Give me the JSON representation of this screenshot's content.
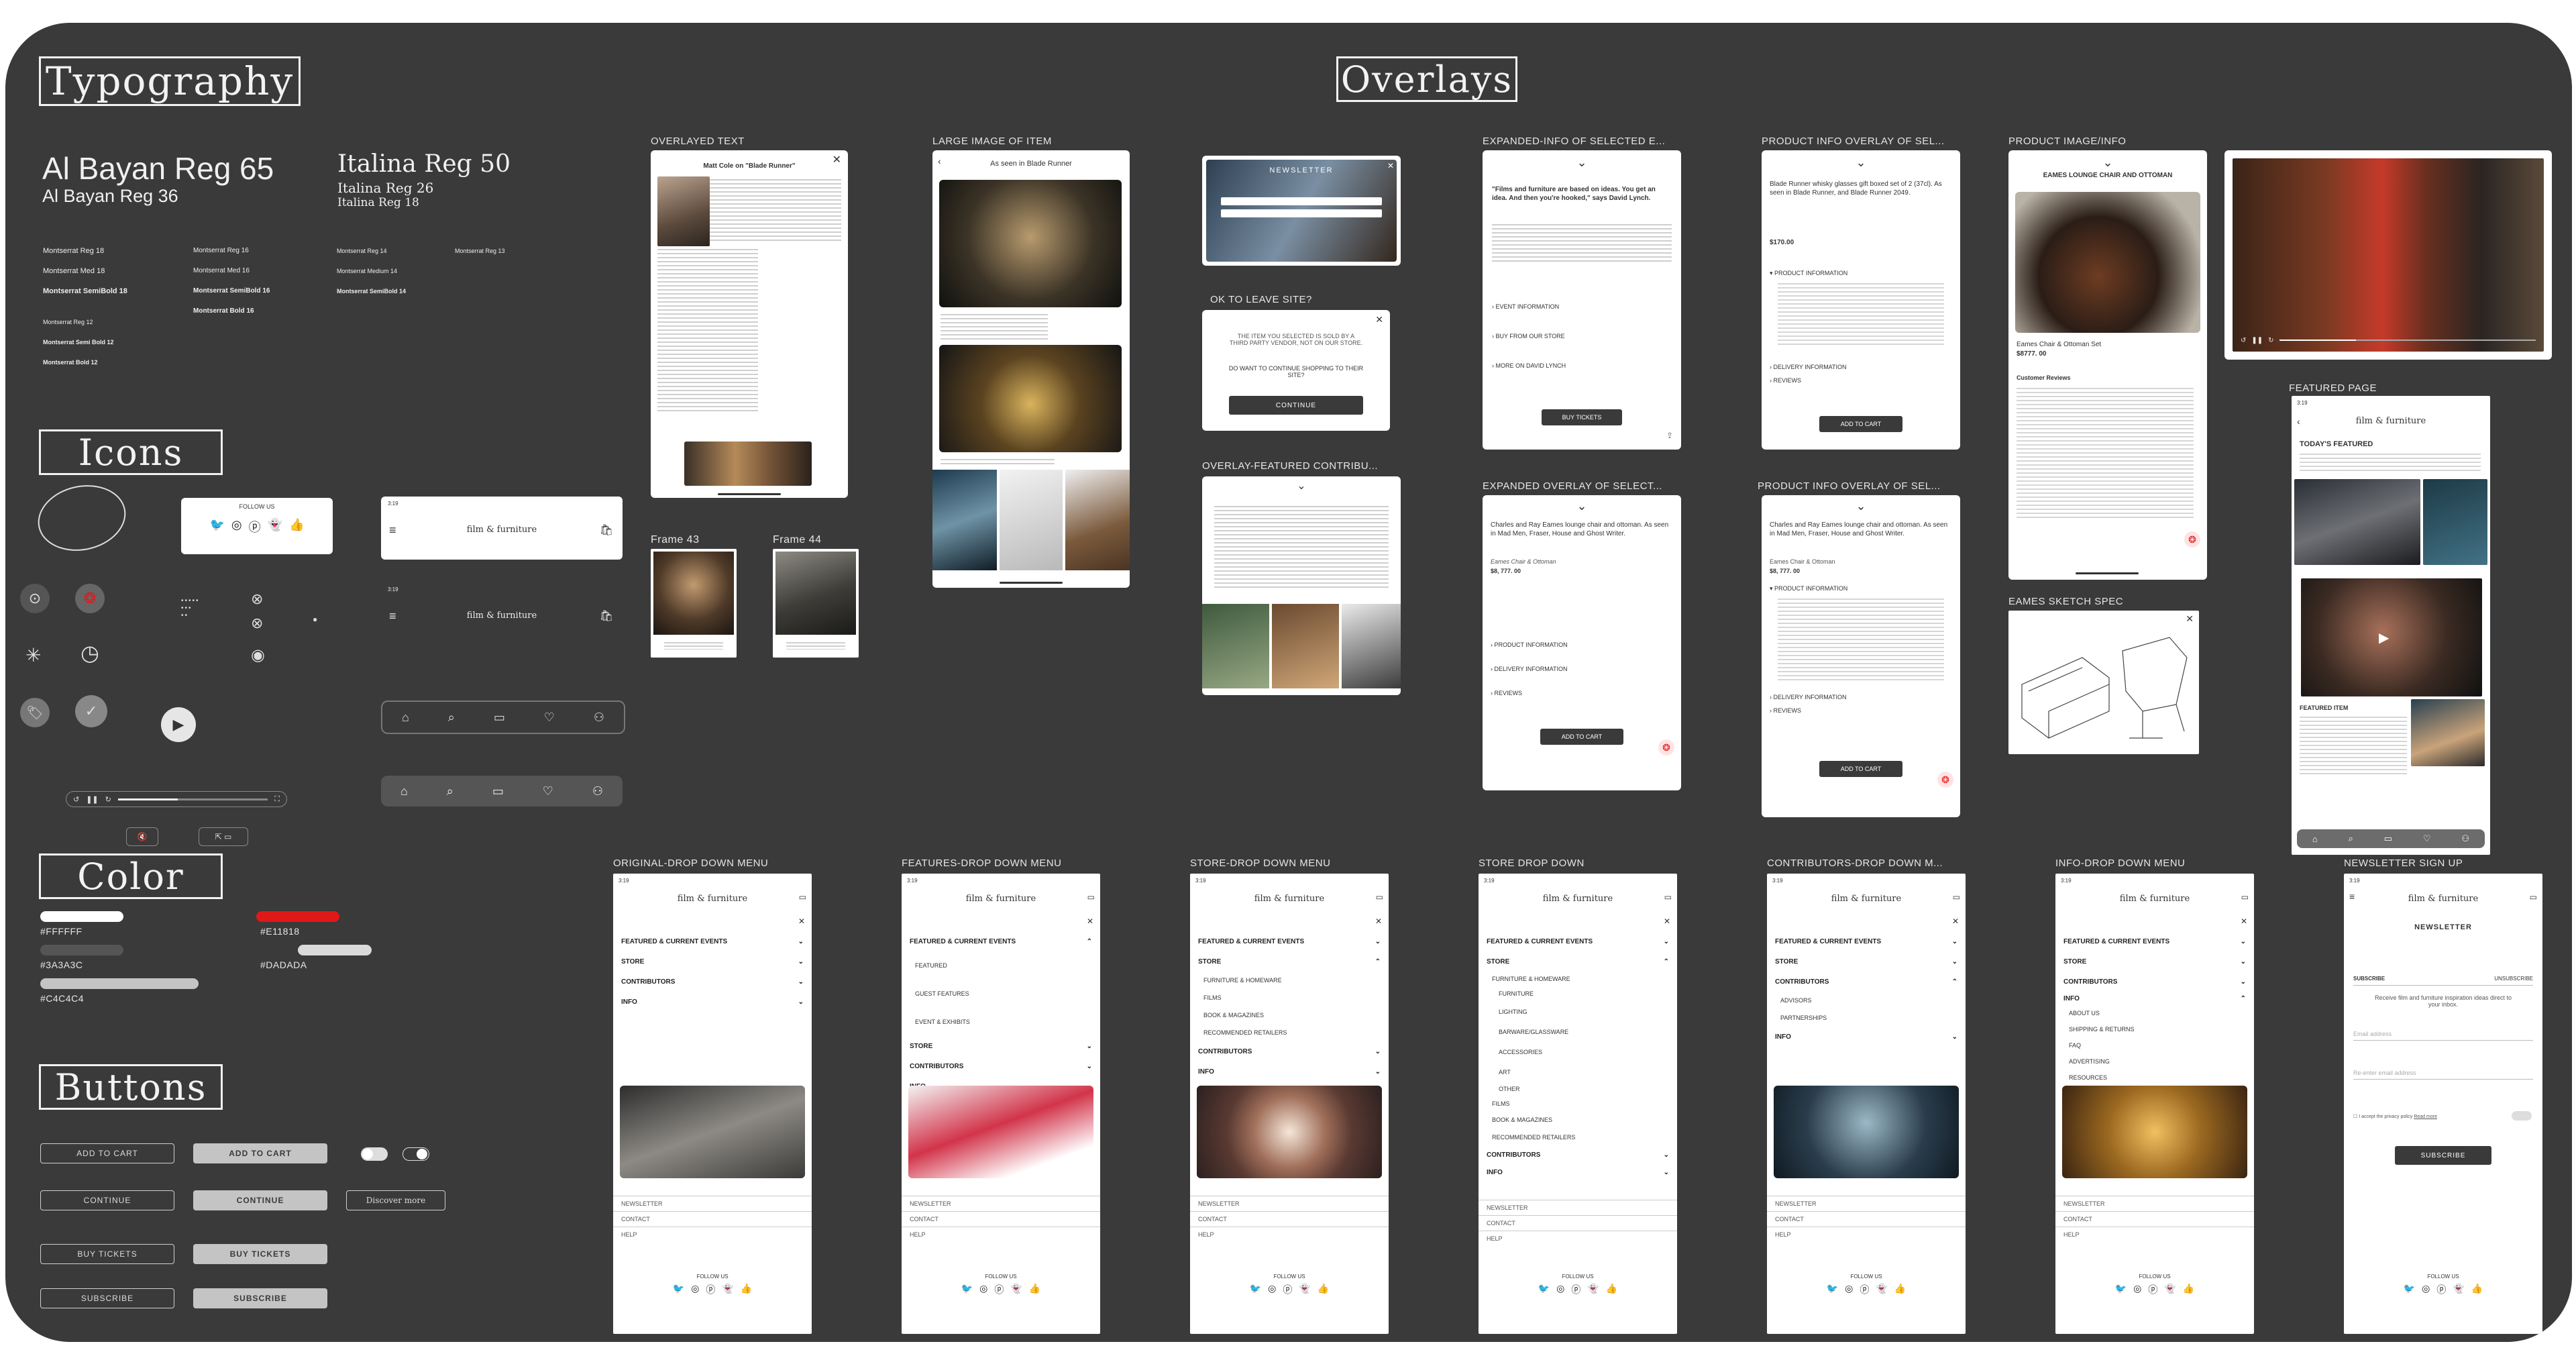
{
  "sections": {
    "typography": "Typography",
    "icons": "Icons",
    "color": "Color",
    "buttons": "Buttons",
    "overlays": "Overlays"
  },
  "typography": {
    "al_65": "Al Bayan Reg 65",
    "al_36": "Al Bayan Reg 36",
    "it_50": "Italina Reg 50",
    "it_26": "Italina Reg 26",
    "it_18": "Italina Reg 18",
    "montA": [
      "Montserrat Reg 18",
      "Montserrat Med 18",
      "Montserrat SemiBold 18",
      "",
      "Montserrat Reg 12",
      "Montserrat Semi Bold 12",
      "Montserrat Bold 12"
    ],
    "montB": [
      "Montserrat Reg 16",
      "Montserrat Med 16",
      "Montserrat SemiBold 16",
      "Montserrat Bold 16"
    ],
    "montC": [
      "Montserrat Reg 14",
      "Montserrat Medium 14",
      "Montserrat SemiBold 14"
    ],
    "montD": "Montserrat Reg 13"
  },
  "icons": {
    "follow_us": "FOLLOW US",
    "logo": "film & furniture",
    "time": "3:19"
  },
  "colors": [
    {
      "hex": "#FFFFFF",
      "label": "#FFFFFF"
    },
    {
      "hex": "#3A3A3C",
      "label": "#3A3A3C"
    },
    {
      "hex": "#C4C4C4",
      "label": "#C4C4C4"
    },
    {
      "hex": "#E11818",
      "label": "#E11818"
    },
    {
      "hex": "#DADADA",
      "label": "#DADADA"
    }
  ],
  "buttons": {
    "add_to_cart": "ADD TO CART",
    "continue": "CONTINUE",
    "buy_tickets": "BUY TICKETS",
    "subscribe": "SUBSCRIBE",
    "discover_more": "Discover more"
  },
  "frames": {
    "overlayed_text": "OVERLAYED TEXT",
    "large_image": "LARGE IMAGE OF ITEM",
    "expanded_info": "EXPANDED-INFO OF SELECTED E...",
    "product_info_1": "PRODUCT INFO OVERLAY OF SEL...",
    "product_image": "PRODUCT IMAGE/INFO",
    "ok_leave": "OK TO LEAVE SITE?",
    "overlay_featured": "OVERLAY-FEATURED CONTRIBU...",
    "expanded_overlay": "EXPANDED OVERLAY OF SELECT...",
    "product_info_2": "PRODUCT INFO OVERLAY OF SEL...",
    "eames_sketch": "EAMES SKETCH SPEC",
    "featured_page": "FEATURED PAGE",
    "frame43": "Frame 43",
    "frame44": "Frame 44",
    "dd_original": "ORIGINAL-DROP DOWN MENU",
    "dd_features": "FEATURES-DROP DOWN MENU",
    "dd_store": "STORE-DROP DOWN MENU",
    "dd_store2": "STORE DROP DOWN",
    "dd_contrib": "CONTRIBUTORS-DROP DOWN M...",
    "dd_info": "INFO-DROP DOWN MENU",
    "newsletter": "NEWSLETTER SIGN UP"
  },
  "overlay_text": {
    "title": "Matt Cole on \"Blade Runner\"",
    "as_seen": "As seen in  Blade Runner",
    "newsletter": "NEWSLETTER",
    "leave_msg": "THE ITEM YOU SELECTED IS SOLD BY A THIRD PARTY VENDOR, NOT ON OUR STORE.",
    "leave_q": "DO WANT TO CONTINUE SHOPPING TO THEIR SITE?",
    "continue": "CONTINUE"
  },
  "expanded": {
    "quote": "\"Films and furniture are based on ideas. You get an idea. And then you're hooked,\" says David Lynch.",
    "items": [
      "EVENT INFORMATION",
      "BUY FROM OUR STORE",
      "MORE ON DAVID LYNCH"
    ],
    "buy": "BUY TICKETS"
  },
  "product1": {
    "title": "Blade Runner whisky glasses gift boxed set of 2 (37cl). As seen in Blade Runner, and Blade Runner 2049.",
    "price": "$170.00",
    "rows": [
      "PRODUCT INFORMATION",
      "DELIVERY INFORMATION",
      "REVIEWS"
    ],
    "cart": "ADD TO CART"
  },
  "product_image": {
    "title": "EAMES LOUNGE CHAIR AND OTTOMAN",
    "name": "Eames Chair & Ottoman Set",
    "price": "$8777. 00",
    "reviews": "Customer Reviews"
  },
  "expanded2": {
    "text": "Charles and Ray Eames lounge chair and ottoman. As seen in Mad Men, Fraser, House and Ghost Writer.",
    "sub": "Eames Chair & Ottoman",
    "price": "$8, 777. 00",
    "rows": [
      "PRODUCT INFORMATION",
      "DELIVERY INFORMATION",
      "REVIEWS"
    ],
    "cart": "ADD TO CART"
  },
  "featured": {
    "todays": "TODAY'S FEATURED",
    "item": "FEATURED ITEM"
  },
  "menus": {
    "main": [
      "FEATURED & CURRENT EVENTS",
      "STORE",
      "CONTRIBUTORS",
      "INFO"
    ],
    "features_sub": [
      "FEATURED",
      "GUEST FEATURES",
      "EVENT & EXHIBITS"
    ],
    "store_sub": [
      "FURNITURE & HOMEWARE",
      "FILMS",
      "BOOK & MAGAZINES",
      "RECOMMENDED RETAILERS"
    ],
    "store2_sub": [
      "FURNITURE & HOMEWARE",
      "FURNITURE",
      "LIGHTING",
      "BARWARE/GLASSWARE",
      "ACCESSORIES",
      "ART",
      "OTHER",
      "FILMS",
      "BOOK & MAGAZINES",
      "RECOMMENDED RETAILERS"
    ],
    "contrib_sub": [
      "ADVISORS",
      "PARTNERSHIPS"
    ],
    "info_sub": [
      "ABOUT US",
      "SHIPPING & RETURNS",
      "FAQ",
      "ADVERTISING",
      "RESOURCES"
    ],
    "footer": [
      "NEWSLETTER",
      "CONTACT",
      "HELP"
    ],
    "follow": "FOLLOW US"
  },
  "newsletter_page": {
    "title": "NEWSLETTER",
    "subscribe": "SUBSCRIBE",
    "unsubscribe": "UNSUBSCRIBE",
    "text": "Receive film and furniture inspiration ideas direct to your inbox.",
    "email": "Email address",
    "reenter": "Re-enter email address",
    "accept": "I accept the privacy policy",
    "read": "Read more",
    "button": "SUBSCRIBE"
  }
}
